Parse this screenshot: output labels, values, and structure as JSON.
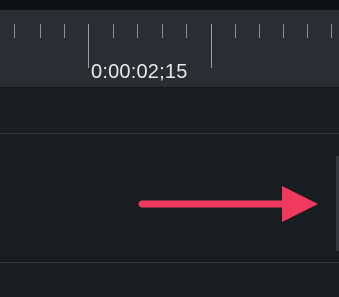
{
  "timeline": {
    "playhead_time": "0:00:02;15"
  },
  "colors": {
    "ruler_bg": "#2a2d31",
    "track_bg": "#1b1e21",
    "arrow": "#f0395f"
  },
  "annotation": {
    "icon": "arrow-right-icon"
  }
}
